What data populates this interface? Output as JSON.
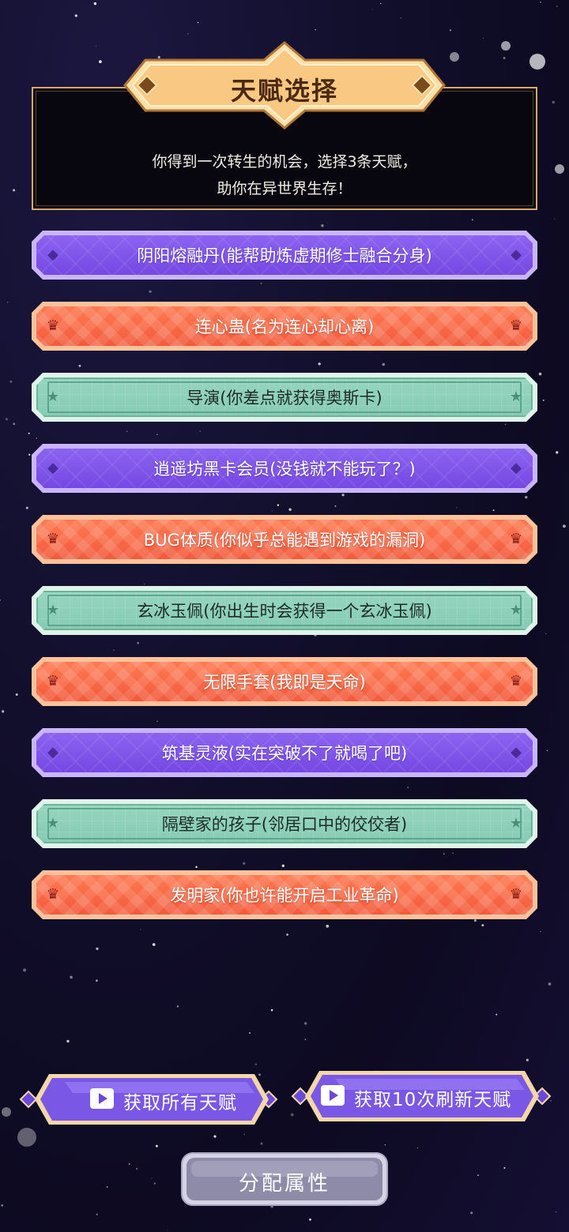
{
  "header": {
    "title": "天赋选择",
    "description": "你得到一次转生的机会，选择3条天赋，\n助你在异世界生存！"
  },
  "colors": {
    "purple": "#7f55ea",
    "red": "#f76647",
    "green": "#8fd2bc",
    "gold": "#f7c37e"
  },
  "talents": [
    {
      "label": "阴阳熔融丹(能帮助炼虚期修士融合分身)",
      "rarity": "purple",
      "icon": "diamond-icon"
    },
    {
      "label": "连心蛊(名为连心却心离)",
      "rarity": "red",
      "icon": "crown-icon"
    },
    {
      "label": "导演(你差点就获得奥斯卡)",
      "rarity": "green",
      "icon": "star-icon"
    },
    {
      "label": "逍遥坊黑卡会员(没钱就不能玩了？)",
      "rarity": "purple",
      "icon": "diamond-icon"
    },
    {
      "label": "BUG体质(你似乎总能遇到游戏的漏洞)",
      "rarity": "red",
      "icon": "crown-icon"
    },
    {
      "label": "玄冰玉佩(你出生时会获得一个玄冰玉佩)",
      "rarity": "green",
      "icon": "star-icon"
    },
    {
      "label": "无限手套(我即是天命)",
      "rarity": "red",
      "icon": "crown-icon"
    },
    {
      "label": "筑基灵液(实在突破不了就喝了吧)",
      "rarity": "purple",
      "icon": "diamond-icon"
    },
    {
      "label": "隔壁家的孩子(邻居口中的佼佼者)",
      "rarity": "green",
      "icon": "star-icon"
    },
    {
      "label": "发明家(你也许能开启工业革命)",
      "rarity": "red",
      "icon": "crown-icon"
    }
  ],
  "buttons": {
    "get_all": "获取所有天赋",
    "refresh": "获取10次刷新天赋",
    "assign": "分配属性"
  }
}
